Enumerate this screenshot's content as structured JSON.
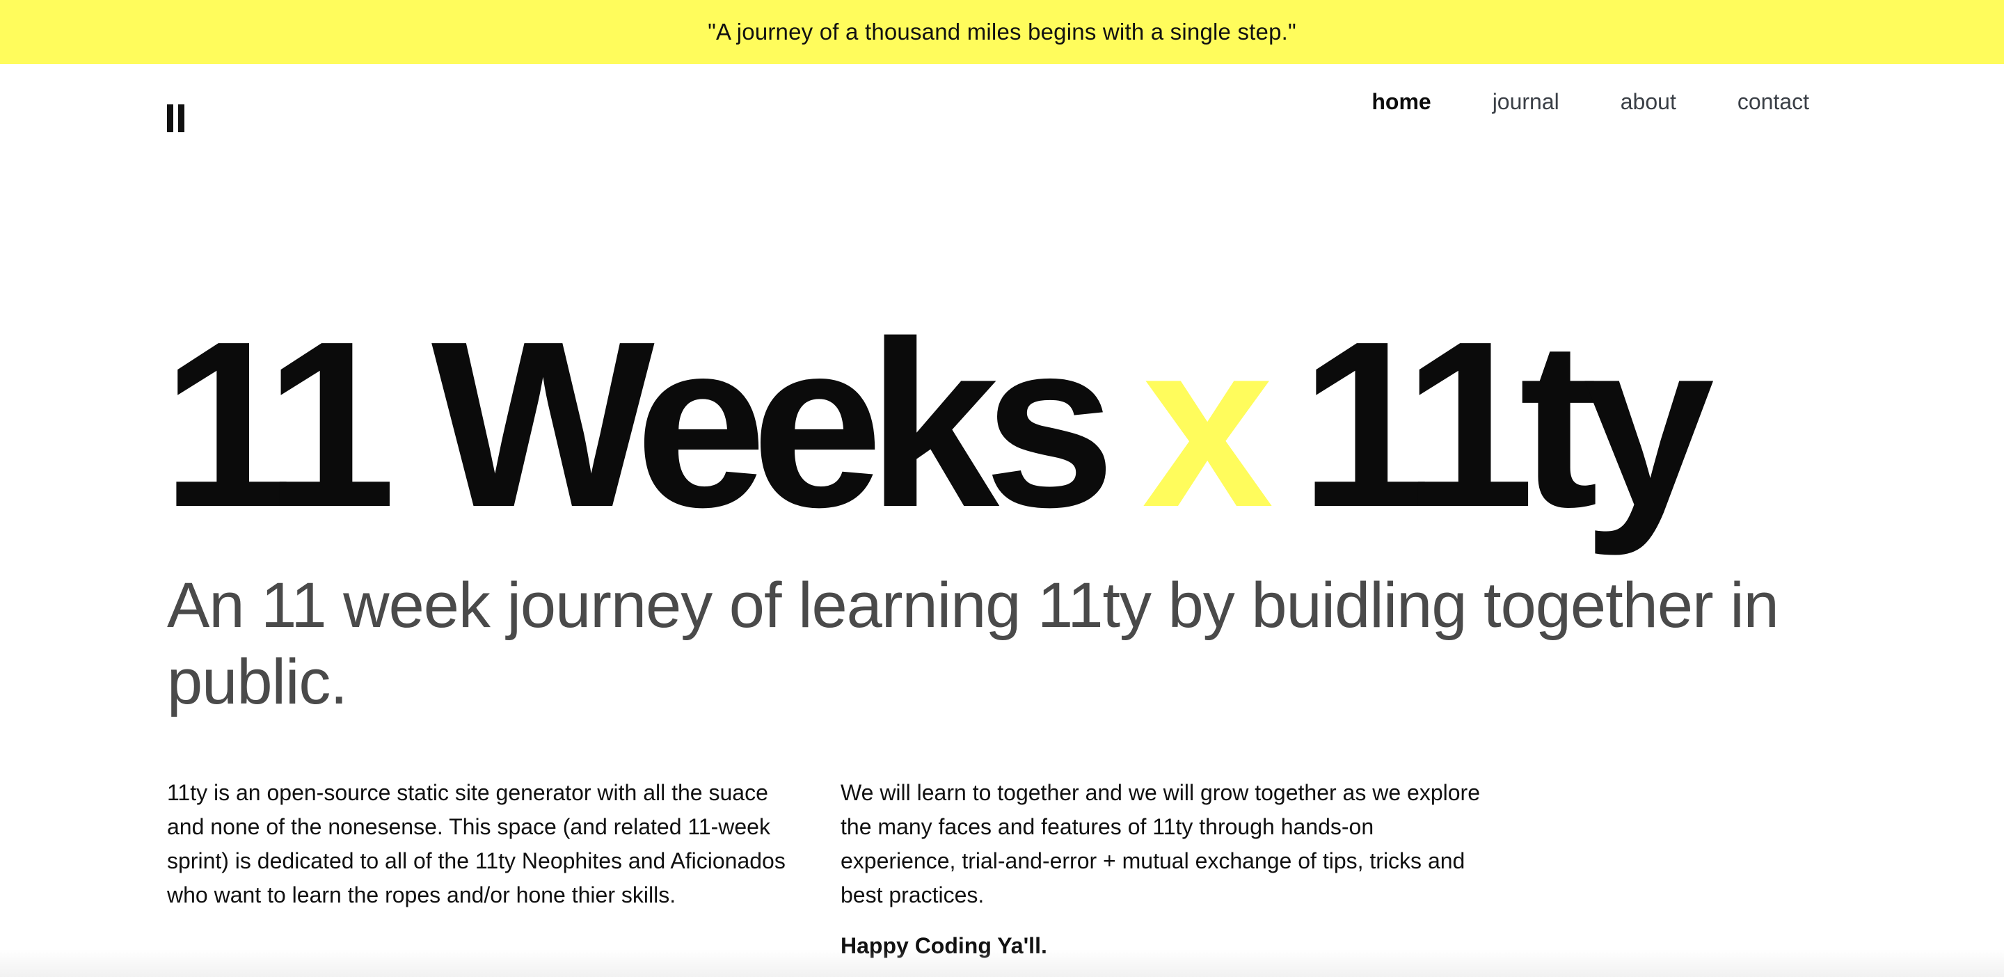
{
  "banner": {
    "quote": "\"A journey of a thousand miles begins with a single step.\""
  },
  "logo": {
    "icon": "double-bar-logo-icon"
  },
  "nav": {
    "items": [
      {
        "label": "home",
        "active": true
      },
      {
        "label": "journal",
        "active": false
      },
      {
        "label": "about",
        "active": false
      },
      {
        "label": "contact",
        "active": false
      }
    ]
  },
  "hero": {
    "title_part1": "11 Weeks",
    "title_accent": "x",
    "title_part2": "11ty",
    "accent_color": "#fffc5c",
    "subtitle": "An 11 week journey of learning 11ty by buidling together in public."
  },
  "intro": {
    "left_paragraph": "11ty is an open-source static site generator with all the suace and none of the nonesense. This space (and related 11-week sprint) is dedicated to all of the 11ty Neophites and Aficionados who want to learn the ropes and/or hone thier skills.",
    "right_paragraph": "We will learn to together and we will grow together as we explore the many faces and features of 11ty through hands-on experience, trial-and-error + mutual exchange of tips, tricks and best practices.",
    "signoff": "Happy Coding Ya'll."
  }
}
